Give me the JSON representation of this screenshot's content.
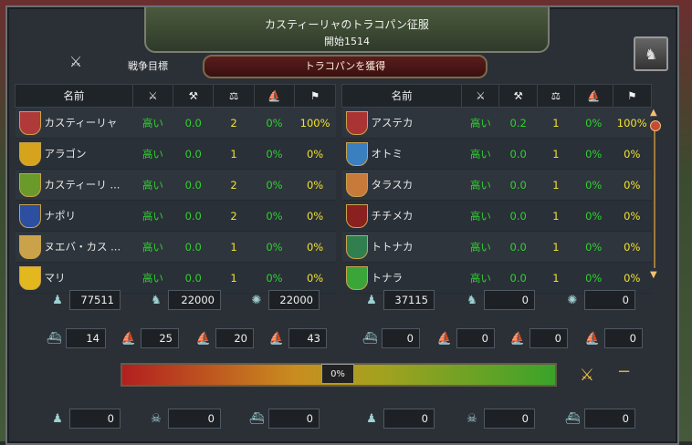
{
  "header": {
    "title": "カスティーリャのトラコパン征服",
    "subtitle": "開始1514"
  },
  "goal": {
    "label": "戦争目標",
    "value": "トラコパンを獲得"
  },
  "columns": {
    "name": "名前"
  },
  "left": [
    {
      "name": "カスティーリャ",
      "a": "高い",
      "b": "0.0",
      "c": "2",
      "d": "0%",
      "e": "100%",
      "flag": "#b03a3a",
      "leader": true
    },
    {
      "name": "アラゴン",
      "a": "高い",
      "b": "0.0",
      "c": "1",
      "d": "0%",
      "e": "0%",
      "flag": "#d6a31c"
    },
    {
      "name": "カスティーリ ...",
      "a": "高い",
      "b": "0.0",
      "c": "2",
      "d": "0%",
      "e": "0%",
      "flag": "#6a9a2a"
    },
    {
      "name": "ナポリ",
      "a": "高い",
      "b": "0.0",
      "c": "2",
      "d": "0%",
      "e": "0%",
      "flag": "#2c4fa1"
    },
    {
      "name": "ヌエバ・カス ...",
      "a": "高い",
      "b": "0.0",
      "c": "1",
      "d": "0%",
      "e": "0%",
      "flag": "#c9a24a"
    },
    {
      "name": "マリ",
      "a": "高い",
      "b": "0.0",
      "c": "1",
      "d": "0%",
      "e": "0%",
      "flag": "#e3b81e"
    }
  ],
  "right": [
    {
      "name": "アステカ",
      "a": "高い",
      "b": "0.2",
      "c": "1",
      "d": "0%",
      "e": "100%",
      "flag": "#a33",
      "leader": false
    },
    {
      "name": "オトミ",
      "a": "高い",
      "b": "0.0",
      "c": "1",
      "d": "0%",
      "e": "0%",
      "flag": "#3a7fbf"
    },
    {
      "name": "タラスカ",
      "a": "高い",
      "b": "0.0",
      "c": "1",
      "d": "0%",
      "e": "0%",
      "flag": "#c77a3a"
    },
    {
      "name": "チチメカ",
      "a": "高い",
      "b": "0.0",
      "c": "1",
      "d": "0%",
      "e": "0%",
      "flag": "#8a2020"
    },
    {
      "name": "トトナカ",
      "a": "高い",
      "b": "0.0",
      "c": "1",
      "d": "0%",
      "e": "0%",
      "flag": "#2f7f4f"
    },
    {
      "name": "トナラ",
      "a": "高い",
      "b": "0.0",
      "c": "1",
      "d": "0%",
      "e": "0%",
      "flag": "#3aa63a"
    }
  ],
  "stats_left_land": [
    "77511",
    "22000",
    "22000"
  ],
  "stats_right_land": [
    "37115",
    "0",
    "0"
  ],
  "stats_left_naval": [
    "14",
    "25",
    "20",
    "43"
  ],
  "stats_right_naval": [
    "0",
    "0",
    "0",
    "0"
  ],
  "bottom": [
    "0",
    "0",
    "0",
    "0",
    "0",
    "0"
  ],
  "war_score": "0%",
  "war_status_dash": "−"
}
